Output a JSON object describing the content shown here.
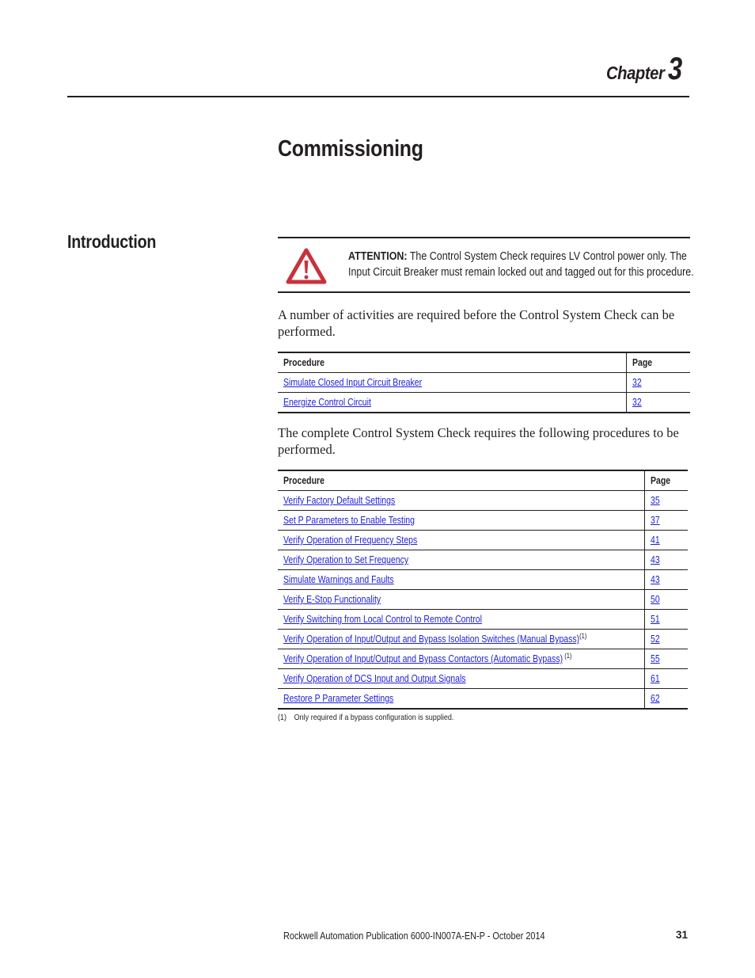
{
  "header": {
    "chapter_label": "Chapter",
    "chapter_number": "3"
  },
  "page_title": "Commissioning",
  "section_title": "Introduction",
  "attention": {
    "icon": "warning-triangle-icon",
    "icon_color": "#c8323c",
    "label": "ATTENTION:",
    "line1": " The Control System Check requires LV Control power only. The",
    "line2": "Input Circuit Breaker must remain locked out and tagged out for this procedure."
  },
  "paragraph1": "A number of activities are required before the Control System Check can be performed.",
  "table1": {
    "columns": [
      "Procedure",
      "Page"
    ],
    "rows": [
      {
        "procedure": "Simulate Closed Input Circuit Breaker",
        "page": "32"
      },
      {
        "procedure": "Energize Control Circuit",
        "page": "32"
      }
    ]
  },
  "paragraph2": "The complete Control System Check requires the following procedures to be performed.",
  "table2": {
    "columns": [
      "Procedure",
      "Page"
    ],
    "rows": [
      {
        "procedure": "Verify Factory Default Settings",
        "page": "35",
        "note": ""
      },
      {
        "procedure": "Set P Parameters to Enable Testing",
        "page": "37",
        "note": ""
      },
      {
        "procedure": "Verify Operation of Frequency Steps",
        "page": "41",
        "note": ""
      },
      {
        "procedure": "Verify Operation to Set Frequency",
        "page": "43",
        "note": ""
      },
      {
        "procedure": "Simulate Warnings and Faults",
        "page": "43",
        "note": ""
      },
      {
        "procedure": "Verify E-Stop Functionality",
        "page": "50",
        "note": ""
      },
      {
        "procedure": "Verify Switching from Local Control to Remote Control",
        "page": "51",
        "note": ""
      },
      {
        "procedure": "Verify Operation of Input/Output and Bypass Isolation Switches (Manual Bypass)",
        "page": "52",
        "note": "(1)"
      },
      {
        "procedure": "Verify Operation of Input/Output and Bypass Contactors (Automatic Bypass)",
        "page": "55",
        "note": " (1)"
      },
      {
        "procedure": "Verify Operation of DCS Input and Output Signals",
        "page": "61",
        "note": ""
      },
      {
        "procedure": "Restore P Parameter Settings",
        "page": "62",
        "note": ""
      }
    ]
  },
  "footnote": {
    "mark": "(1)",
    "text": "Only required if a bypass configuration is supplied."
  },
  "footer": {
    "publication": "Rockwell Automation Publication 6000-IN007A-EN-P - October 2014",
    "page_number": "31"
  },
  "colors": {
    "link": "#1f1fd6",
    "text": "#231f20",
    "warning": "#c8323c"
  }
}
